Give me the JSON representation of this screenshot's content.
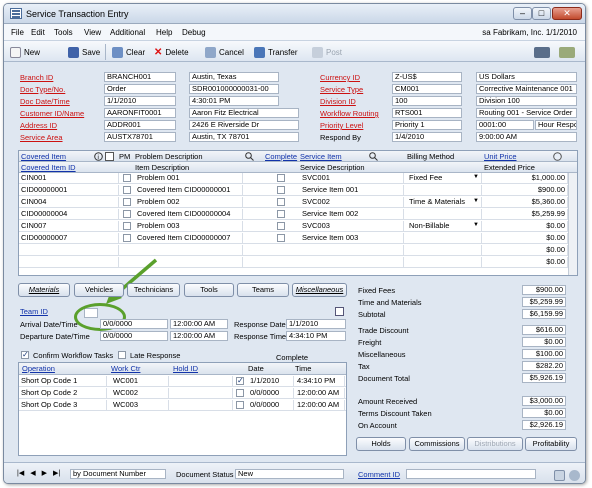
{
  "window": {
    "title": "Service Transaction Entry"
  },
  "menu": [
    "File",
    "Edit",
    "Tools",
    "View",
    "Additional",
    "Help",
    "Debug"
  ],
  "company": "sa  Fabrikam, Inc.  1/1/2010",
  "toolbar": {
    "new": "New",
    "save": "Save",
    "clear": "Clear",
    "delete": "Delete",
    "cancel": "Cancel",
    "transfer": "Transfer",
    "post": "Post"
  },
  "header_left": [
    {
      "label": "Branch ID",
      "value": "BRANCH001",
      "desc": "Austin, Texas"
    },
    {
      "label": "Doc Type/No.",
      "value": "Order",
      "desc": "SDR001000000031-00"
    },
    {
      "label": "Doc Date/Time",
      "value": "1/1/2010",
      "desc": "4:30:01 PM"
    },
    {
      "label": "Customer ID/Name",
      "value": "AARONFIT0001",
      "desc": "Aaron Fitz Electrical"
    },
    {
      "label": "Address ID",
      "value": "ADDR001",
      "desc": "2426 E Riverside Dr"
    },
    {
      "label": "Service Area",
      "value": "AUSTX78701",
      "desc": "Austin, TX 78701"
    }
  ],
  "header_right": [
    {
      "label": "Currency ID",
      "value": "Z-US$",
      "desc": "US Dollars"
    },
    {
      "label": "Service Type",
      "value": "CM001",
      "desc": "Corrective Maintenance 001"
    },
    {
      "label": "Division ID",
      "value": "100",
      "desc": "Division 100"
    },
    {
      "label": "Workflow Routing",
      "value": "RTS001",
      "desc": "Routing 001 - Service Order"
    },
    {
      "label": "Priority Level",
      "value": "Priority 1",
      "desc": "0001:00",
      "desc2": "Hour Response"
    },
    {
      "label": "Respond By",
      "value": "1/4/2010",
      "desc": "9:00:00 AM"
    }
  ],
  "main_grid": {
    "h1": {
      "covered_item": "Covered Item",
      "pm": "PM",
      "problem_desc": "Problem Description",
      "complete": "Complete",
      "service_item": "Service Item",
      "billing_method": "Billing Method",
      "unit_price": "Unit Price"
    },
    "h2": {
      "covered_item_id": "Covered Item ID",
      "item_desc": "Item Description",
      "service_desc": "Service Description",
      "extended_price": "Extended Price"
    },
    "rows": [
      {
        "a": "CIN001",
        "b": "Problem 001",
        "c": "SVC001",
        "d": "Fixed Fee",
        "e": "$1,000.00"
      },
      {
        "a": "CID00000001",
        "b": "Covered Item CID00000001",
        "c": "Service Item 001",
        "d": "",
        "e": "$900.00"
      },
      {
        "a": "CIN004",
        "b": "Problem 002",
        "c": "SVC002",
        "d": "Time & Materials",
        "e": "$5,360.00"
      },
      {
        "a": "CID00000004",
        "b": "Covered Item CID00000004",
        "c": "Service Item 002",
        "d": "",
        "e": "$5,259.99"
      },
      {
        "a": "CIN007",
        "b": "Problem 003",
        "c": "SVC003",
        "d": "Non-Billable",
        "e": "$0.00"
      },
      {
        "a": "CID00000007",
        "b": "Covered Item CID00000007",
        "c": "Service Item 003",
        "d": "",
        "e": "$0.00"
      },
      {
        "a": "",
        "b": "",
        "c": "",
        "d": "",
        "e": "$0.00"
      },
      {
        "a": "",
        "b": "",
        "c": "",
        "d": "",
        "e": "$0.00"
      }
    ]
  },
  "tabs": [
    "Materials",
    "Vehicles",
    "Technicians",
    "Tools",
    "Teams",
    "Miscellaneous"
  ],
  "team": {
    "label": "Team ID"
  },
  "times": [
    {
      "label": "Arrival Date/Time",
      "date": "0/0/0000",
      "time": "12:00:00 AM",
      "label2": "Response Date",
      "val2": "1/1/2010"
    },
    {
      "label": "Departure Date/Time",
      "date": "0/0/0000",
      "time": "12:00:00 AM",
      "label2": "Response Time",
      "val2": "4:34:10 PM"
    }
  ],
  "confirm_workflow": "Confirm Workflow Tasks",
  "late_response": "Late Response",
  "ops_grid": {
    "headers": {
      "operation": "Operation",
      "work_ctr": "Work Ctr",
      "hold_id": "Hold ID",
      "complete": "Complete",
      "date": "Date",
      "time": "Time"
    },
    "rows": [
      {
        "op": "Short Op Code 1",
        "wc": "WC001",
        "checked": true,
        "date": "1/1/2010",
        "time": "4:34:10 PM"
      },
      {
        "op": "Short Op Code 2",
        "wc": "WC002",
        "checked": false,
        "date": "0/0/0000",
        "time": "12:00:00 AM"
      },
      {
        "op": "Short Op Code 3",
        "wc": "WC003",
        "checked": false,
        "date": "0/0/0000",
        "time": "12:00:00 AM"
      }
    ]
  },
  "totals": [
    {
      "label": "Fixed Fees",
      "value": "$900.00"
    },
    {
      "label": "Time and Materials",
      "value": "$5,259.99"
    },
    {
      "label": "Subtotal",
      "value": "$6,159.99"
    },
    {
      "label": "Trade Discount",
      "value": "$616.00"
    },
    {
      "label": "Freight",
      "value": "$0.00"
    },
    {
      "label": "Miscellaneous",
      "value": "$100.00"
    },
    {
      "label": "Tax",
      "value": "$282.20"
    },
    {
      "label": "Document Total",
      "value": "$5,926.19"
    },
    {
      "label": "Amount Received",
      "value": "$3,000.00"
    },
    {
      "label": "Terms Discount Taken",
      "value": "$0.00"
    },
    {
      "label": "On Account",
      "value": "$2,926.19"
    }
  ],
  "bottom_buttons": {
    "holds": "Holds",
    "commissions": "Commissions",
    "distributions": "Distributions",
    "profitability": "Profitability"
  },
  "status": {
    "sort": "by Document Number",
    "doc_status_label": "Document Status",
    "doc_status": "New",
    "comment_id": "Comment ID"
  },
  "colors": {
    "accent": "#1233aa",
    "required": "#cc1111",
    "highlight": "#5aa02c"
  }
}
